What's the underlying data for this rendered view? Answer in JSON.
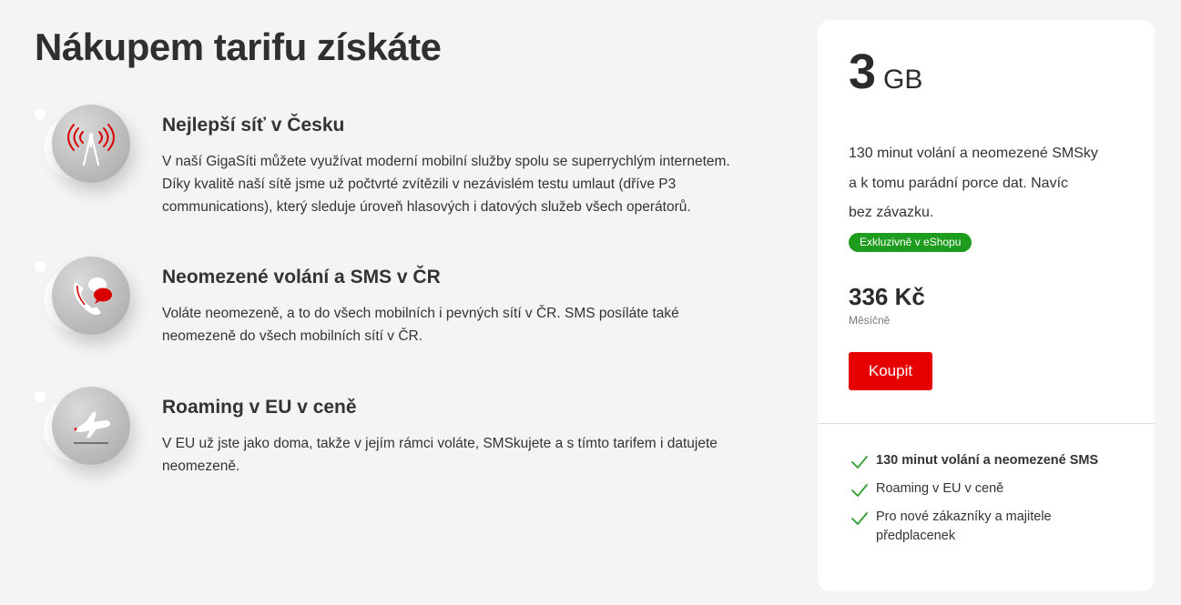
{
  "section": {
    "title": "Nákupem tarifu získáte"
  },
  "features": [
    {
      "icon": "signal-tower-icon",
      "title": "Nejlepší síť v Česku",
      "text_lines": [
        "V naší GigaSíti můžete využívat moderní mobilní služby spolu se superrychlým internetem.",
        "Díky kvalitě naší sítě jsme už počtvrté zvítězili v nezávislém testu umlaut (dříve P3",
        "communications), který sleduje úroveň hlasových i datových služeb všech operátorů."
      ]
    },
    {
      "icon": "phone-message-icon",
      "title": "Neomezené volání a SMS v ČR",
      "text_lines": [
        "Voláte neomezeně, a to do všech mobilních i pevných sítí v ČR. SMS posíláte také",
        "neomezeně do všech mobilních sítí v ČR."
      ]
    },
    {
      "icon": "airplane-icon",
      "title": "Roaming v EU v ceně",
      "text_lines": [
        "V EU už jste jako doma, takže v jejím rámci voláte, SMSkujete a s tímto tarifem i datujete",
        "neomezeně."
      ]
    }
  ],
  "tariff_card": {
    "data_amount": "3",
    "data_unit": "GB",
    "description_lines": [
      "130 minut volání a neomezené SMSky",
      "a k tomu parádní porce dat. Navíc",
      "bez závazku."
    ],
    "badge": "Exkluzivně v eShopu",
    "price": "336 Kč",
    "price_period": "Měsíčně",
    "buy_label": "Koupit",
    "benefits": [
      {
        "text": "130 minut volání a neomezené SMS",
        "bold": true
      },
      {
        "text": "Roaming v EU v ceně",
        "bold": false
      },
      {
        "text_lines": [
          "Pro nové zákazníky a majitele",
          "předplacenek"
        ],
        "bold": false
      }
    ]
  },
  "colors": {
    "background": "#f4f4f4",
    "card": "#ffffff",
    "brand_red": "#e60000",
    "badge_green": "#1d9c1d",
    "check_green": "#2e9e2e",
    "text": "#333333"
  }
}
